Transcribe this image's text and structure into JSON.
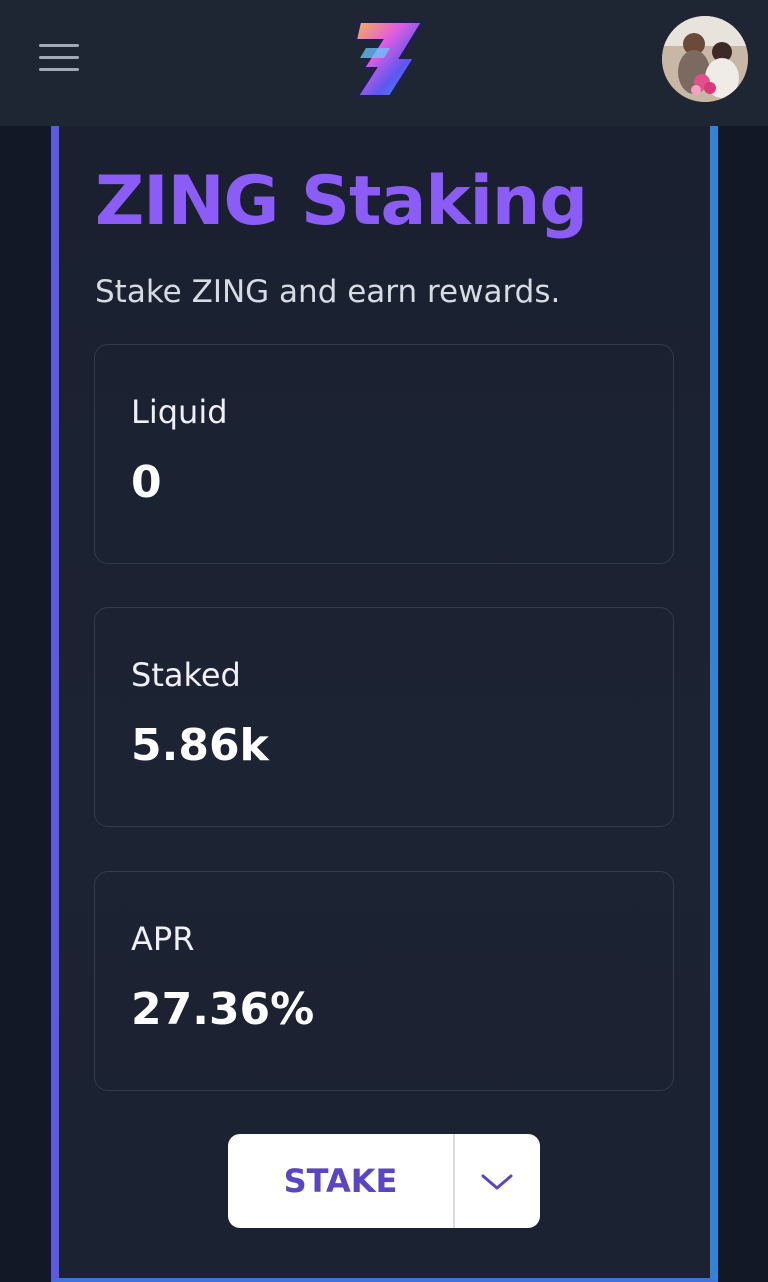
{
  "header": {
    "menu_icon": "hamburger-menu-icon",
    "logo_icon": "zing-logo-icon",
    "avatar_icon": "user-avatar"
  },
  "main": {
    "title": "ZING Staking",
    "subtitle": "Stake ZING and earn rewards.",
    "stats": [
      {
        "label": "Liquid",
        "value": "0"
      },
      {
        "label": "Staked",
        "value": "5.86k"
      },
      {
        "label": "APR",
        "value": "27.36%"
      }
    ],
    "stake_button_label": "STAKE",
    "dropdown_icon": "chevron-down-icon"
  },
  "colors": {
    "accent": "#8b5cf6",
    "button_text": "#5a46c4",
    "background": "#121826",
    "header": "#1f2633"
  }
}
